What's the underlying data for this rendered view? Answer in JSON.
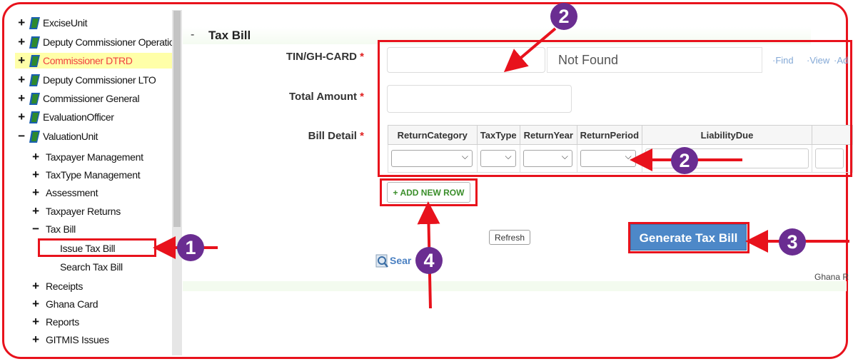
{
  "sidebar": {
    "top_items": [
      {
        "label": "ExciseUnit",
        "expand": "+"
      },
      {
        "label": "Deputy Commissioner Operations",
        "expand": "+"
      },
      {
        "label": "Commissioner DTRD",
        "expand": "+"
      },
      {
        "label": "Deputy Commissioner LTO",
        "expand": "+"
      },
      {
        "label": "Commissioner General",
        "expand": "+"
      },
      {
        "label": "EvaluationOfficer",
        "expand": "+"
      },
      {
        "label": "ValuationUnit",
        "expand": "−"
      }
    ],
    "sub_items": [
      {
        "label": "Taxpayer Management",
        "expand": "+"
      },
      {
        "label": "TaxType Management",
        "expand": "+"
      },
      {
        "label": "Assessment",
        "expand": "+"
      },
      {
        "label": "Taxpayer Returns",
        "expand": "+"
      },
      {
        "label": "Tax Bill",
        "expand": "−"
      }
    ],
    "leaf_items": [
      {
        "label": "Issue Tax Bill"
      },
      {
        "label": "Search Tax Bill"
      }
    ],
    "sub_items_after": [
      {
        "label": "Receipts",
        "expand": "+"
      },
      {
        "label": "Ghana Card",
        "expand": "+"
      },
      {
        "label": "Reports",
        "expand": "+"
      },
      {
        "label": "GITMIS Issues",
        "expand": "+"
      }
    ]
  },
  "main": {
    "collapse_sign": "-",
    "title": "Tax Bill",
    "fields": {
      "tin_label": "TIN/GH-CARD",
      "total_label": "Total Amount",
      "bill_label": "Bill Detail",
      "required_mark": "*"
    },
    "tin_value": "",
    "name_value": "Not Found",
    "total_value": "",
    "links": {
      "find": "Find",
      "view": "View",
      "add": "Ad"
    },
    "table": {
      "headers": [
        "ReturnCategory",
        "TaxType",
        "ReturnYear",
        "ReturnPeriod",
        "LiabilityDue",
        ""
      ]
    },
    "add_row_label": "+ ADD NEW ROW",
    "refresh_label": "Refresh",
    "generate_label": "Generate Tax Bill",
    "search_label": "Sear",
    "footer_text": "Ghana R"
  },
  "annotations": {
    "numbers": [
      "1",
      "2",
      "2",
      "3",
      "4"
    ],
    "color": "#e8121c",
    "badge_color": "#6a2d91"
  }
}
